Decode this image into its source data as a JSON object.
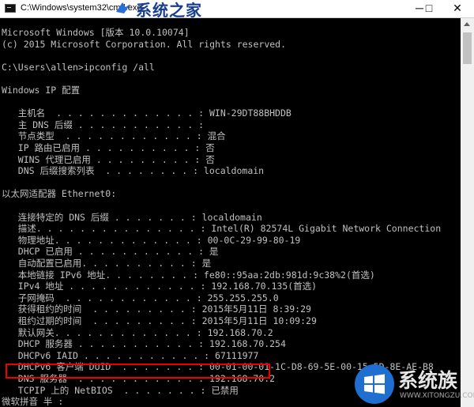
{
  "window": {
    "title": "C:\\Windows\\system32\\cmd.exe",
    "minimize": "─",
    "maximize": "□",
    "close": "✕"
  },
  "watermark": {
    "top_text": "系统之家",
    "bottom_text": "系统族",
    "bottom_url": "WWW.XITONGZU.COM"
  },
  "console_lines": [
    "Microsoft Windows [版本 10.0.10074]",
    "(c) 2015 Microsoft Corporation. All rights reserved.",
    "",
    "C:\\Users\\allen>ipconfig /all",
    "",
    "Windows IP 配置",
    "",
    "   主机名  . . . . . . . . . . . . . : WIN-29DT88BHDDB",
    "   主 DNS 后缀 . . . . . . . . . . . :",
    "   节点类型  . . . . . . . . . . . . : 混合",
    "   IP 路由已启用 . . . . . . . . . . : 否",
    "   WINS 代理已启用 . . . . . . . . . : 否",
    "   DNS 后缀搜索列表  . . . . . . . . : localdomain",
    "",
    "以太网适配器 Ethernet0:",
    "",
    "   连接特定的 DNS 后缀 . . . . . . . : localdomain",
    "   描述. . . . . . . . . . . . . . . : Intel(R) 82574L Gigabit Network Connection",
    "   物理地址. . . . . . . . . . . . . : 00-0C-29-99-80-19",
    "   DHCP 已启用 . . . . . . . . . . . : 是",
    "   自动配置已启用. . . . . . . . . . : 是",
    "   本地链接 IPv6 地址. . . . . . . . : fe80::95aa:2db:981d:9c38%2(首选)",
    "   IPv4 地址 . . . . . . . . . . . . : 192.168.70.135(首选)",
    "   子网掩码  . . . . . . . . . . . . : 255.255.255.0",
    "   获得租约的时间  . . . . . . . . . : 2015年5月11日 8:39:29",
    "   租约过期的时间  . . . . . . . . . : 2015年5月11日 10:09:29",
    "   默认网关. . . . . . . . . . . . . : 192.168.70.2",
    "   DHCP 服务器 . . . . . . . . . . . : 192.168.70.254",
    "   DHCPv6 IAID . . . . . . . . . . . : 67111977",
    "   DHCPv6 客户端 DUID  . . . . . . . : 00-01-00-01-1C-D8-69-5E-00-15-5D-8E-AE-B8",
    "   DNS 服务器  . . . . . . . . . . . : 192.168.70.2",
    "   TCPIP 上的 NetBIOS  . . . . . . . : 已禁用",
    "微软拼音 半 :"
  ]
}
